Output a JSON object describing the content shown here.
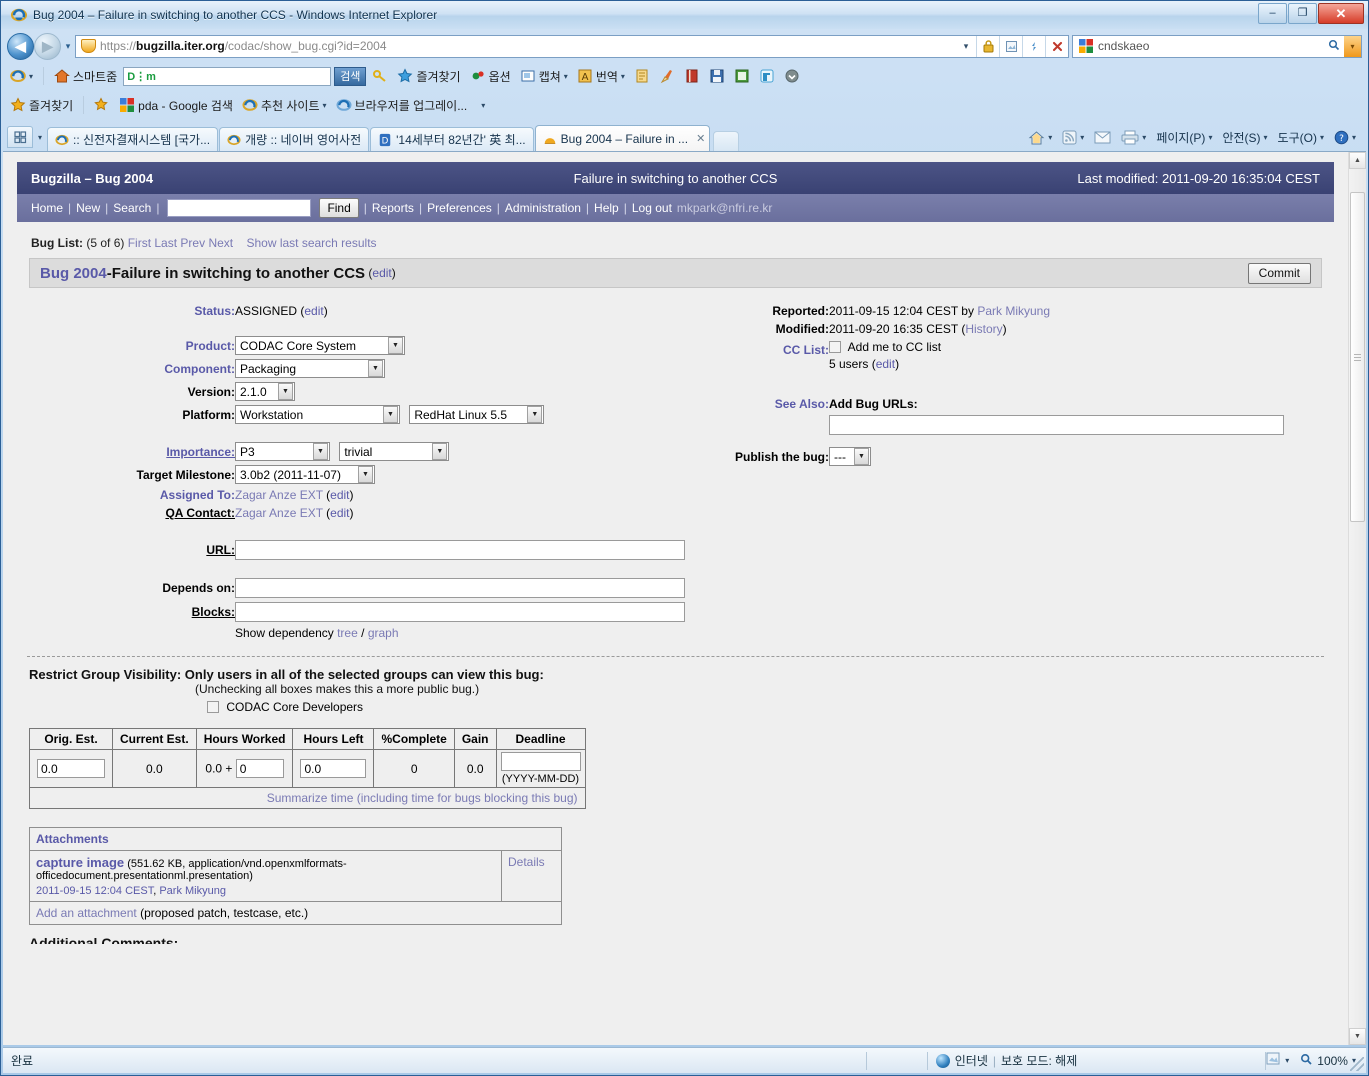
{
  "window": {
    "title": "Bug 2004 – Failure in switching to another CCS - Windows Internet Explorer",
    "minimize": "–",
    "maximize": "❐",
    "close": "✕"
  },
  "address_bar": {
    "url_protocol": "https://",
    "url_host": "bugzilla.iter.org",
    "url_path": "/codac/show_bug.cgi?id=2004",
    "url_full": "https://bugzilla.iter.org/codac/show_bug.cgi?id=2004",
    "back_glyph": "◀",
    "forward_glyph": "▶",
    "recent_caret": "▾",
    "dropdown_caret": "▾",
    "icons": [
      "lock-icon",
      "compat-view-icon",
      "refresh-icon",
      "stop-icon"
    ],
    "search": {
      "value": "cndskaeo",
      "provider_icon": "google-icon",
      "search_glyph": "🔍",
      "caret": "▾"
    }
  },
  "toolbar_row1": {
    "ie_menu_caret": "▾",
    "smart_zoom": "스마트줌",
    "naver_box": {
      "brand": "D⋮m",
      "value": "",
      "button": "검색"
    },
    "items": [
      {
        "label": "즐겨찾기",
        "icon": "star-icon",
        "caret": ""
      },
      {
        "label": "옵션",
        "icon": "option-icon",
        "caret": ""
      },
      {
        "label": "캡쳐",
        "icon": "capture-icon",
        "caret": "▾"
      },
      {
        "label": "번역",
        "icon": "translate-icon",
        "caret": "▾"
      }
    ],
    "trailing_icons": [
      "memo-icon",
      "broom-icon",
      "book-icon",
      "save-icon",
      "note-icon",
      "twitter-icon",
      "more-icon"
    ]
  },
  "toolbar_row2": {
    "favorites_label": "즐겨찾기",
    "items": [
      {
        "label": "pda - Google 검색",
        "icon": "google-icon"
      },
      {
        "label": "추천 사이트",
        "icon": "ie-icon",
        "caret": "▾"
      },
      {
        "label": "브라우저를 업그레이...",
        "icon": "ie-icon",
        "caret": ""
      }
    ],
    "overflow_caret": "▾"
  },
  "tabs": {
    "quicktab_caret": "▾",
    "items": [
      {
        "label": ":: 신전자결재시스템 [국가...",
        "icon": "ie-icon",
        "active": false
      },
      {
        "label": "개량 :: 네이버 영어사전",
        "icon": "ie-icon",
        "active": false
      },
      {
        "label": "'14세부터 82년간' 英 최...",
        "icon": "doc-icon",
        "active": false
      },
      {
        "label": "Bug 2004 – Failure in ...",
        "icon": "bugzilla-icon",
        "active": true,
        "close": "✕"
      }
    ],
    "command_bar": [
      {
        "label": "",
        "icon": "home-icon",
        "caret": "▾"
      },
      {
        "label": "",
        "icon": "feeds-icon",
        "caret": "▾"
      },
      {
        "label": "",
        "icon": "mail-icon",
        "caret": ""
      },
      {
        "label": "",
        "icon": "print-icon",
        "caret": "▾"
      },
      {
        "label": "페이지(P)",
        "icon": "",
        "caret": "▾"
      },
      {
        "label": "안전(S)",
        "icon": "",
        "caret": "▾"
      },
      {
        "label": "도구(O)",
        "icon": "",
        "caret": "▾"
      },
      {
        "label": "",
        "icon": "help-icon",
        "caret": "▾"
      }
    ]
  },
  "bugzilla": {
    "header": {
      "left": "Bugzilla – Bug 2004",
      "center": "Failure in switching to another CCS",
      "right": "Last modified: 2011-09-20 16:35:04 CEST"
    },
    "nav": {
      "home": "Home",
      "new": "New",
      "search": "Search",
      "query_value": "",
      "find_button": "Find",
      "reports": "Reports",
      "preferences": "Preferences",
      "administration": "Administration",
      "help": "Help",
      "logout": "Log out",
      "user": "mkpark@nfri.re.kr",
      "sep": "|"
    },
    "bug_list": {
      "label": "Bug List:",
      "count": "(5 of 6)",
      "first": "First",
      "last": "Last",
      "prev": "Prev",
      "next": "Next",
      "show_last": "Show last search results"
    },
    "title_bar": {
      "bug_number": "Bug 2004",
      "dash": " - ",
      "summary": "Failure in switching to another CCS",
      "edit": "edit",
      "commit": "Commit"
    },
    "left_fields": {
      "status_label": "Status:",
      "status_value": "ASSIGNED",
      "status_edit": "edit",
      "product_label": "Product:",
      "product_value": "CODAC Core System",
      "component_label": "Component:",
      "component_value": "Packaging",
      "version_label": "Version:",
      "version_value": "2.1.0",
      "platform_label": "Platform:",
      "platform_value": "Workstation",
      "os_value": "RedHat Linux 5.5",
      "importance_label": "Importance:",
      "importance_priority": "P3",
      "importance_severity": "trivial",
      "milestone_label": "Target Milestone:",
      "milestone_value": "3.0b2 (2011-11-07)",
      "assigned_label": "Assigned To:",
      "assigned_value": "Zagar Anze EXT",
      "assigned_edit": "edit",
      "qa_label": "QA Contact:",
      "qa_value": "Zagar Anze EXT",
      "qa_edit": "edit",
      "url_label": "URL:",
      "url_value": "",
      "depends_label": "Depends on:",
      "depends_value": "",
      "blocks_label": "Blocks:",
      "blocks_value": "",
      "dep_prefix": "Show dependency",
      "dep_tree": "tree",
      "dep_slash": "/",
      "dep_graph": "graph"
    },
    "right_fields": {
      "reported_label": "Reported:",
      "reported_value": "2011-09-15 12:04 CEST by",
      "reported_by": "Park Mikyung",
      "modified_label": "Modified:",
      "modified_value": "2011-09-20 16:35 CEST",
      "history_open": "(",
      "history": "History",
      "history_close": ")",
      "cc_label": "CC List:",
      "cc_checkbox_label": "Add me to CC list",
      "cc_users": "5 users",
      "cc_edit": "edit",
      "see_also_label": "See Also:",
      "see_also_title": "Add Bug URLs:",
      "see_also_value": "",
      "publish_label": "Publish the bug:",
      "publish_value": "---"
    },
    "groups": {
      "title": "Restrict Group Visibility: Only users in all of the selected groups can view this bug:",
      "subtitle": "(Unchecking all boxes makes this a more public bug.)",
      "item": "CODAC Core Developers"
    },
    "time_table": {
      "headers": [
        "Orig. Est.",
        "Current Est.",
        "Hours Worked",
        "Hours Left",
        "%Complete",
        "Gain",
        "Deadline"
      ],
      "orig_est": "0.0",
      "current_est": "0.0",
      "hours_worked_base": "0.0 +",
      "hours_worked_add": "0",
      "hours_left": "0.0",
      "percent_complete": "0",
      "gain": "0.0",
      "deadline_value": "",
      "deadline_hint": "(YYYY-MM-DD)",
      "summarize": "Summarize time (including time for bugs blocking this bug)"
    },
    "attachments": {
      "title": "Attachments",
      "rows": [
        {
          "name": "capture image",
          "meta": "(551.62 KB, application/vnd.openxmlformats-officedocument.presentationml.presentation)",
          "date": "2011-09-15 12:04 CEST",
          "comma": ", ",
          "author": "Park Mikyung",
          "details": "Details"
        }
      ],
      "add_link": "Add an attachment",
      "add_note": "(proposed patch, testcase, etc.)"
    },
    "additional_comments_cut": "Additional Comments:"
  },
  "status_bar": {
    "status": "완료",
    "zone_icon": "globe-icon",
    "zone": "인터넷",
    "sep": "|",
    "protected_mode": "보호 모드: 해제",
    "zoom_icon": "zoom-icon",
    "zoom": "100%",
    "caret": "▾",
    "compat_caret": "▾"
  },
  "scrollbar": {
    "up": "▲",
    "down": "▼"
  },
  "colors": {
    "bz_header": "#41497d",
    "bz_nav": "#7277a5",
    "link": "#5959a8",
    "page_bg": "#efefef",
    "title_bar_bg": "#dcdcdc"
  }
}
